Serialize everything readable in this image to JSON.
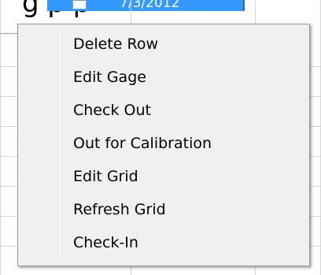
{
  "background": {
    "partial_title": "g   p  p",
    "selected_row": {
      "date": "7/3/2012"
    }
  },
  "context_menu": {
    "items": [
      {
        "label": "Delete Row"
      },
      {
        "label": "Edit Gage"
      },
      {
        "label": "Check Out"
      },
      {
        "label": "Out for Calibration"
      },
      {
        "label": "Edit Grid"
      },
      {
        "label": "Refresh Grid"
      },
      {
        "label": "Check-In"
      }
    ]
  },
  "colors": {
    "menu_background": "#f0f0f0",
    "menu_border": "#979797",
    "selection": "#3399ff",
    "grid_line": "#d4d4d4",
    "text": "#000000"
  }
}
